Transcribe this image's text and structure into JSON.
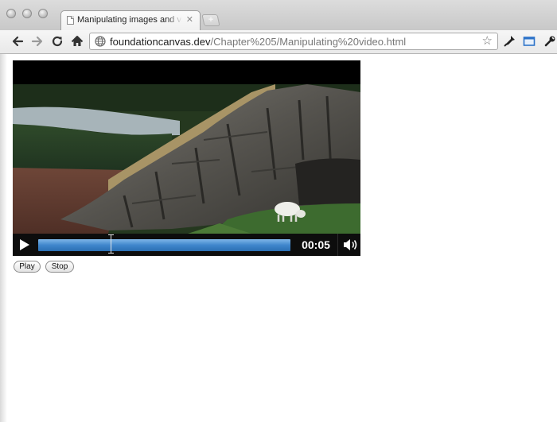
{
  "browser": {
    "tab": {
      "title": "Manipulating images and video",
      "close_glyph": "✕"
    },
    "new_tab_glyph": "+",
    "toolbar": {
      "back_icon": "arrow-left-icon",
      "forward_icon": "arrow-right-icon",
      "reload_icon": "reload-icon",
      "home_icon": "home-icon",
      "url_host": "foundationcanvas.dev",
      "url_path": "/Chapter%205/Manipulating%20video.html",
      "bookmark_icon": "star-icon",
      "extension_icons": [
        "pen-nib-icon",
        "window-icon",
        "wrench-icon"
      ]
    }
  },
  "page": {
    "video": {
      "current_time": "00:05",
      "progress_fraction": 1.0
    },
    "buttons": {
      "play_label": "Play",
      "stop_label": "Stop"
    }
  },
  "colors": {
    "scrubber": "#3f86cc",
    "video_background": "#000000",
    "controls_background": "#0d0d0d"
  }
}
